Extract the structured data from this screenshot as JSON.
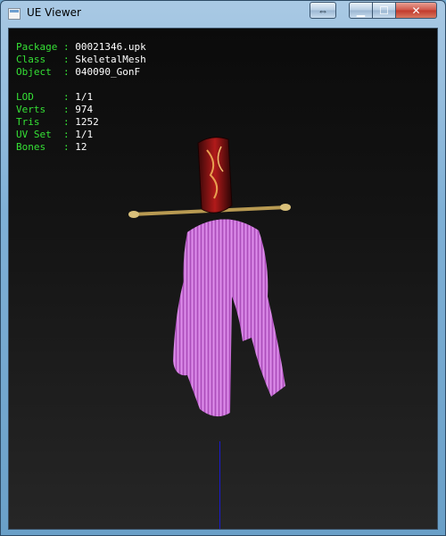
{
  "window": {
    "title": "UE Viewer"
  },
  "titlebar_buttons": {
    "resize_glyph": "⇔",
    "minimize_glyph": "▁",
    "maximize_glyph": "☐",
    "close_glyph": "✕"
  },
  "info": [
    {
      "key": "Package",
      "value": "00021346.upk"
    },
    {
      "key": "Class  ",
      "value": "SkeletalMesh"
    },
    {
      "key": "Object ",
      "value": "040090_GonF"
    },
    {
      "key": "",
      "value": ""
    },
    {
      "key": "LOD    ",
      "value": "1/1"
    },
    {
      "key": "Verts  ",
      "value": "974"
    },
    {
      "key": "Tris   ",
      "value": "1252"
    },
    {
      "key": "UV Set ",
      "value": "1/1"
    },
    {
      "key": "Bones  ",
      "value": "12"
    }
  ],
  "colors": {
    "label": "#35e035",
    "value": "#ffffff",
    "hair": "#c96ad8",
    "axis": "#1a1ad0"
  }
}
